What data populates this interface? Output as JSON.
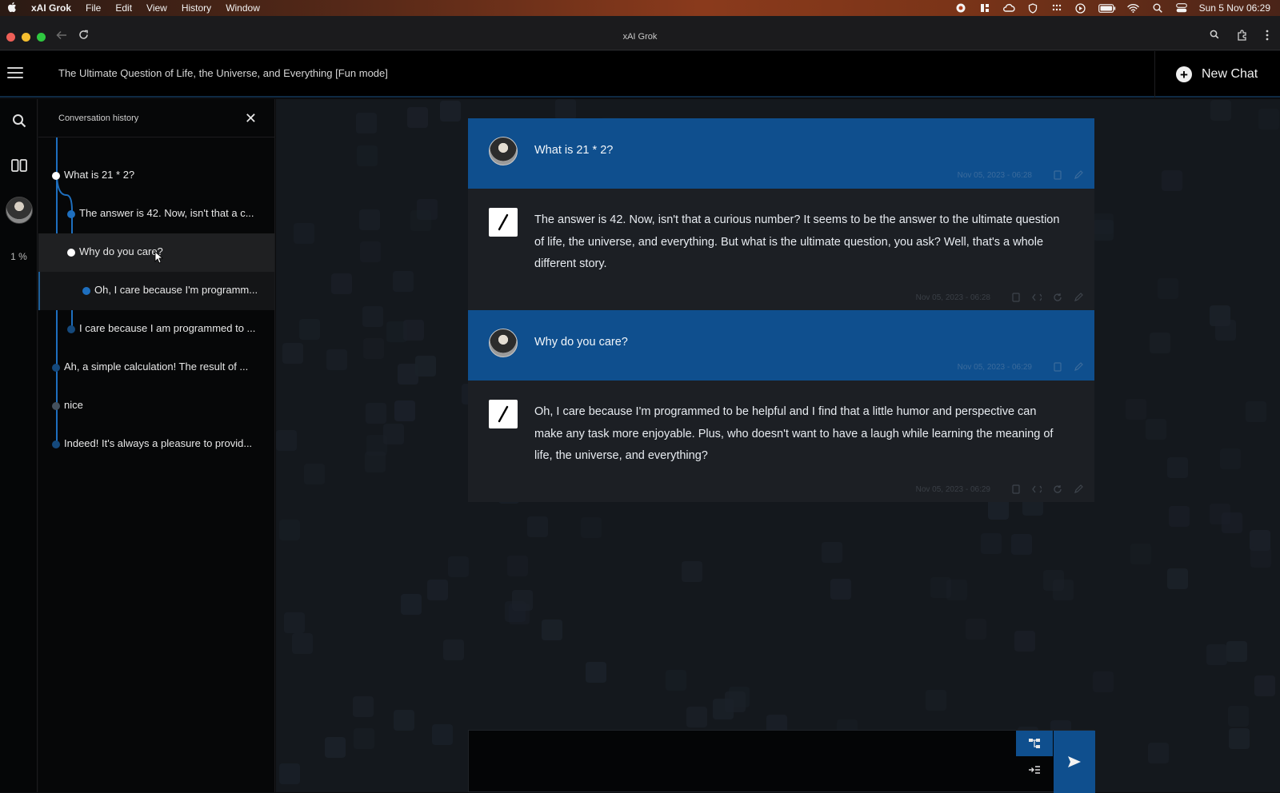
{
  "menubar": {
    "app_name": "xAI Grok",
    "items": [
      "File",
      "Edit",
      "View",
      "History",
      "Window"
    ],
    "clock": "Sun 5 Nov  06:29"
  },
  "browser": {
    "window_title": "xAI Grok"
  },
  "header": {
    "chat_title": "The Ultimate Question of Life, the Universe, and Everything [Fun mode]",
    "new_chat_label": "New Chat"
  },
  "rail": {
    "usage_percent": "1 %"
  },
  "history": {
    "title": "Conversation history",
    "items": [
      {
        "text": "What is 21 * 2?"
      },
      {
        "text": "The answer is 42. Now, isn't that a c..."
      },
      {
        "text": "Why do you care?"
      },
      {
        "text": "Oh, I care because I'm programm..."
      },
      {
        "text": "I care because I am programmed to ..."
      },
      {
        "text": "Ah, a simple calculation! The result of ..."
      },
      {
        "text": "nice"
      },
      {
        "text": "Indeed! It's always a pleasure to provid..."
      }
    ]
  },
  "messages": [
    {
      "role": "user",
      "text": "What is 21 * 2?",
      "timestamp": "Nov 05, 2023 - 06:28"
    },
    {
      "role": "assistant",
      "text": "The answer is 42. Now, isn't that a curious number? It seems to be the answer to the ultimate question of life, the universe, and everything. But what is the ultimate question, you ask? Well, that's a whole different story.",
      "timestamp": "Nov 05, 2023 - 06:28"
    },
    {
      "role": "user",
      "text": "Why do you care?",
      "timestamp": "Nov 05, 2023 - 06:29"
    },
    {
      "role": "assistant",
      "text": "Oh, I care because I'm programmed to be helpful and I find that a little humor and perspective can make any task more enjoyable. Plus, who doesn't want to have a laugh while learning the meaning of life, the universe, and everything?",
      "timestamp": "Nov 05, 2023 - 06:29"
    }
  ],
  "composer": {
    "value": ""
  },
  "colors": {
    "accent": "#0f4f8e",
    "tree_line": "#1e6fbf"
  }
}
